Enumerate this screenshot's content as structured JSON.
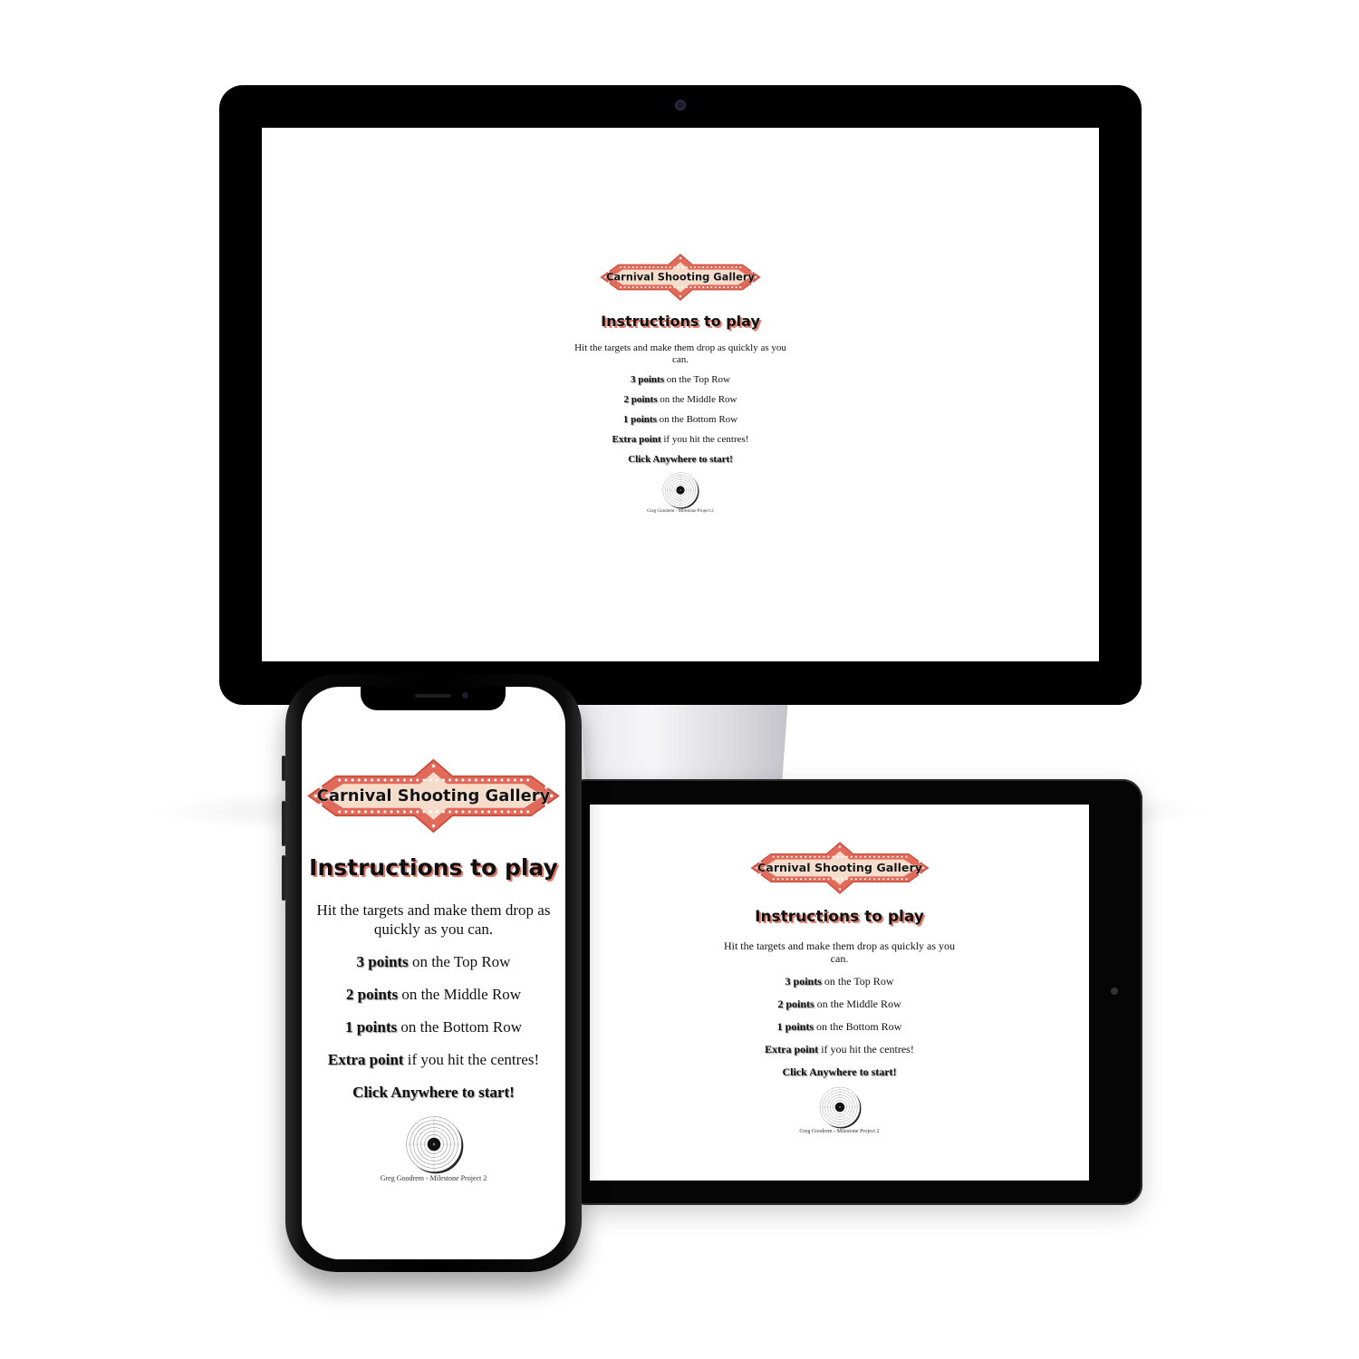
{
  "game": {
    "title": "Carnival Shooting Gallery",
    "heading": "Instructions to play",
    "intro": "Hit the targets and make them drop as quickly as you can.",
    "rules": [
      {
        "strong": "3 points",
        "rest": " on the Top Row"
      },
      {
        "strong": "2 points",
        "rest": " on the Middle Row"
      },
      {
        "strong": "1 points",
        "rest": " on the Bottom Row"
      },
      {
        "strong": "Extra point",
        "rest": " if you hit the centres!"
      }
    ],
    "start": "Click Anywhere to start!",
    "credit": "Greg Goodrem - Milestone Project 2"
  },
  "colors": {
    "banner_fill": "#f6dccb",
    "banner_border": "#e26a5a",
    "bulb": "#ffffff",
    "heading_shadow": "#e07a6a",
    "device_frame": "#000000"
  },
  "icons": {
    "logo": "carnival-marquee-banner",
    "target": "bullseye-target-icon"
  }
}
